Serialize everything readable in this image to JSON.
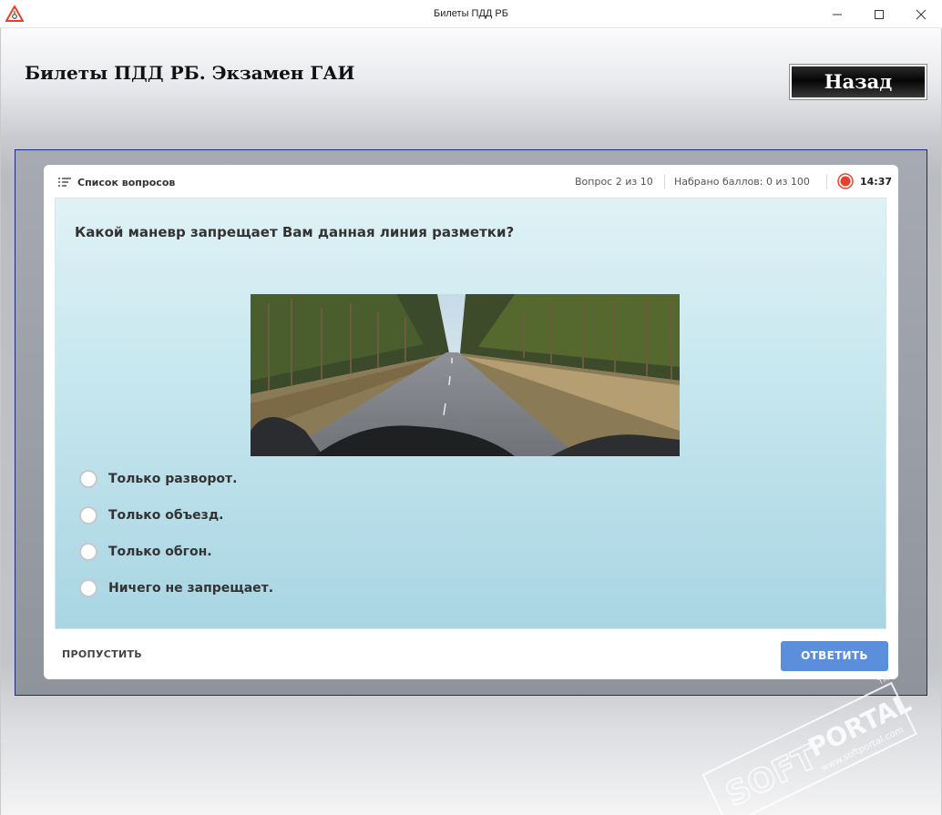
{
  "window": {
    "title": "Билеты ПДД РБ",
    "app_icon": "warning-triangle-icon"
  },
  "app": {
    "heading": "Билеты ПДД РБ. Экзамен ГАИ",
    "back_label": "Назад"
  },
  "card": {
    "list_label": "Список вопросов",
    "question_counter": "Вопрос 2 из 10",
    "score": "Набрано баллов: 0 из 100",
    "timer": "14:37"
  },
  "question": {
    "text": "Какой маневр запрещает Вам данная линия разметки?",
    "answers": [
      "Только разворот.",
      "Только объезд.",
      "Только обгон.",
      "Ничего не запрещает."
    ]
  },
  "footer": {
    "skip_label": "ПРОПУСТИТЬ",
    "answer_label": "ОТВЕТИТЬ"
  },
  "watermark": {
    "text": "PORTAL",
    "url": "www.softportal.com",
    "tm": "TM"
  },
  "colors": {
    "accent_button": "#5b8fdc",
    "frame_border": "#1e2a80",
    "timer_red": "#e8412b"
  }
}
